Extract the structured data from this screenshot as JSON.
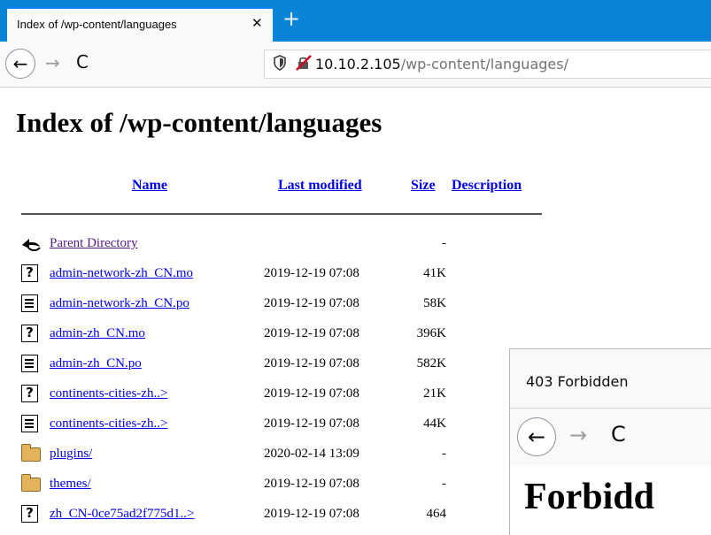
{
  "browser": {
    "tab_title": "Index of /wp-content/languages",
    "tab_close": "✕",
    "new_tab": "+",
    "back": "←",
    "forward": "→",
    "reload": "C",
    "url_host": "10.10.2.105",
    "url_path": "/wp-content/languages/"
  },
  "page": {
    "heading": "Index of /wp-content/languages",
    "columns": {
      "name": "Name",
      "last_modified": "Last modified",
      "size": "Size",
      "description": "Description"
    },
    "rows": [
      {
        "icon": "back-arrow-icon",
        "name": "Parent Directory",
        "date": "",
        "size": "-"
      },
      {
        "icon": "unknown-file-icon",
        "name": "admin-network-zh_CN.mo",
        "date": "2019-12-19 07:08",
        "size": "41K"
      },
      {
        "icon": "text-file-icon",
        "name": "admin-network-zh_CN.po",
        "date": "2019-12-19 07:08",
        "size": "58K"
      },
      {
        "icon": "unknown-file-icon",
        "name": "admin-zh_CN.mo",
        "date": "2019-12-19 07:08",
        "size": "396K"
      },
      {
        "icon": "text-file-icon",
        "name": "admin-zh_CN.po",
        "date": "2019-12-19 07:08",
        "size": "582K"
      },
      {
        "icon": "unknown-file-icon",
        "name": "continents-cities-zh..>",
        "date": "2019-12-19 07:08",
        "size": "21K"
      },
      {
        "icon": "text-file-icon",
        "name": "continents-cities-zh..>",
        "date": "2019-12-19 07:08",
        "size": "44K"
      },
      {
        "icon": "folder-icon",
        "name": "plugins/",
        "date": "2020-02-14 13:09",
        "size": "-"
      },
      {
        "icon": "folder-icon",
        "name": "themes/",
        "date": "2019-12-19 07:08",
        "size": "-"
      },
      {
        "icon": "unknown-file-icon",
        "name": "zh_CN-0ce75ad2f775d1..>",
        "date": "2019-12-19 07:08",
        "size": "464"
      }
    ]
  },
  "second_window": {
    "title": "403 Forbidden",
    "back": "←",
    "forward": "→",
    "reload": "C",
    "heading": "Forbidd"
  }
}
